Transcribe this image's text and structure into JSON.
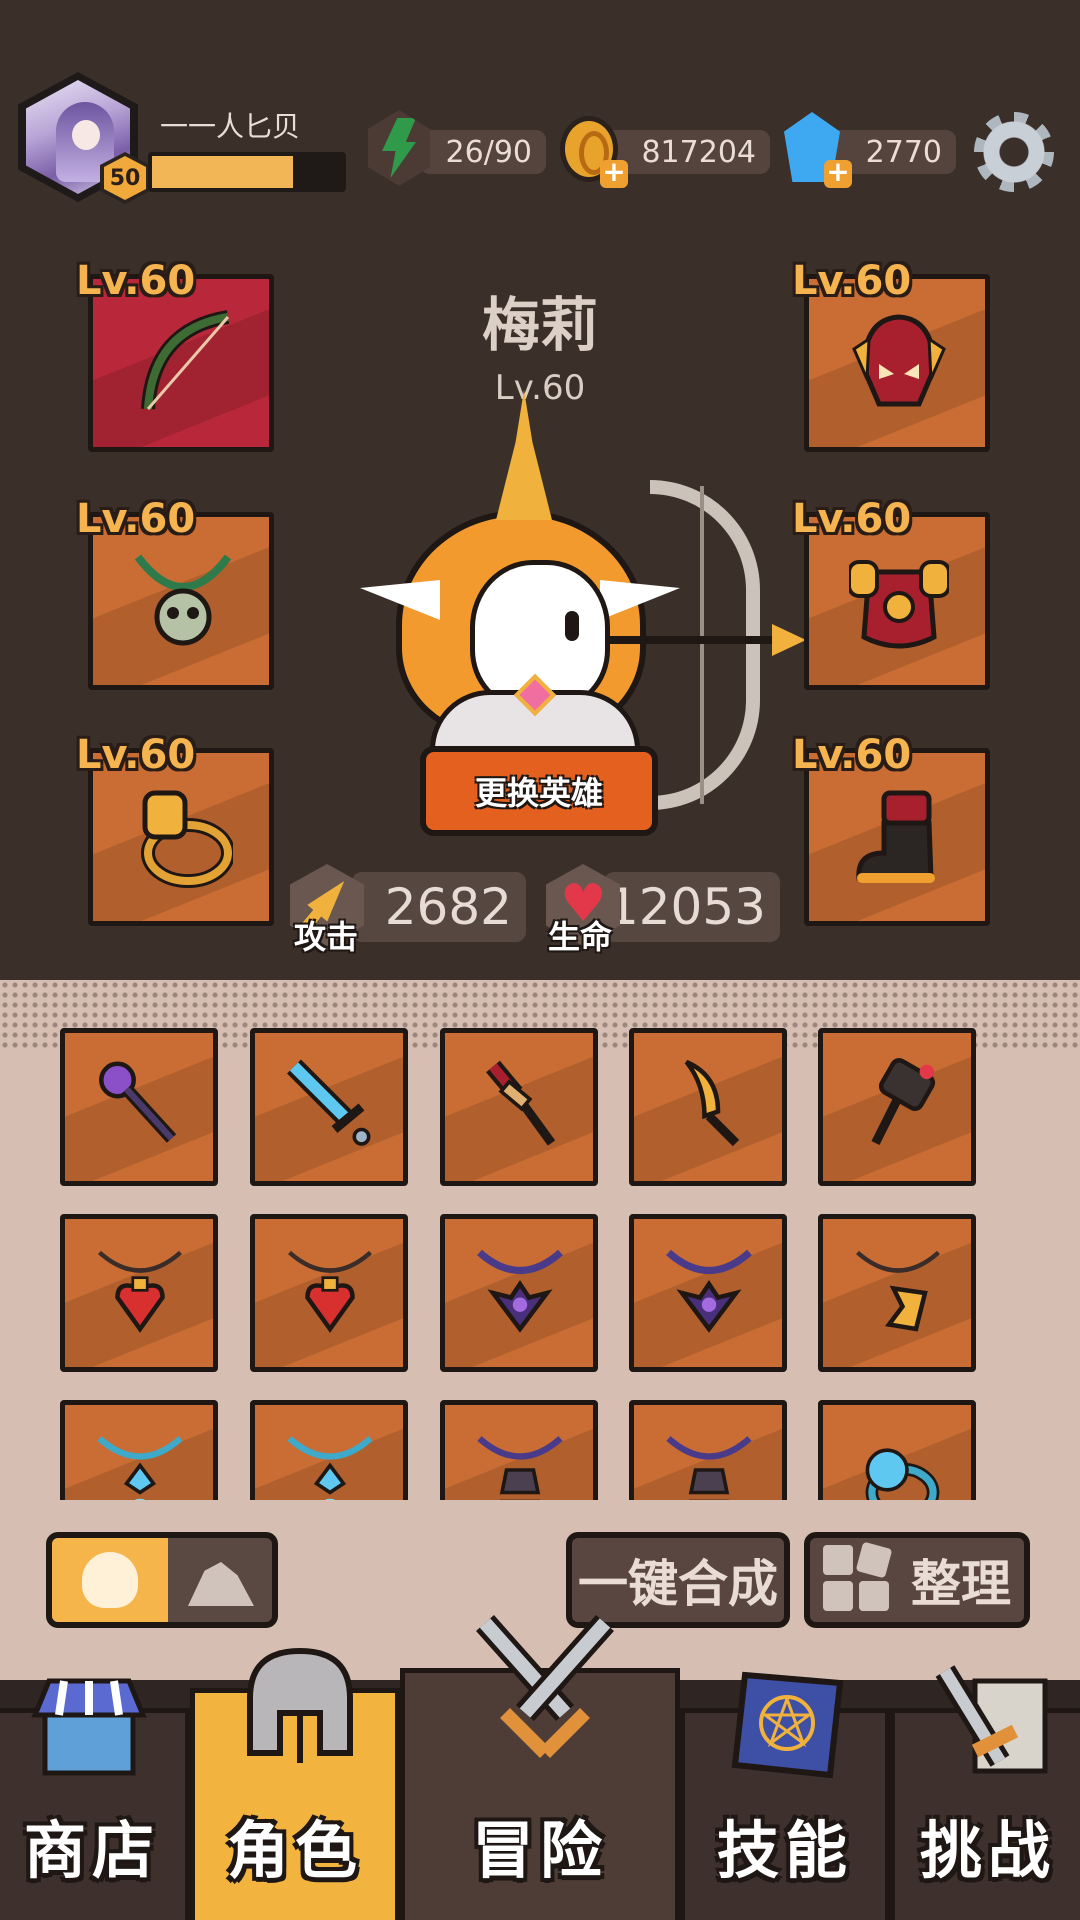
{
  "header": {
    "player_name": "一一人匕贝",
    "player_level": "50",
    "xp_progress": 0.74,
    "energy": "26/90",
    "coins": "817204",
    "gems": "2770"
  },
  "hero": {
    "name": "梅莉",
    "level": "Lv.60",
    "swap_label": "更换英雄",
    "attack_label": "攻击",
    "attack_value": "2682",
    "hp_label": "生命",
    "hp_value": "12053"
  },
  "equipment": {
    "bow_level": "Lv.60",
    "necklace_level": "Lv.60",
    "ring_level": "Lv.60",
    "helmet_level": "Lv.60",
    "armor_level": "Lv.60",
    "boots_level": "Lv.60"
  },
  "inventory": {
    "rows": [
      [
        "staff-icon",
        "sword-icon",
        "dagger-icon",
        "scimitar-icon",
        "hammer-icon"
      ],
      [
        "heart-pendant-icon",
        "heart-pendant-icon",
        "dark-pendant-icon",
        "dark-pendant-icon",
        "axe-pendant-icon"
      ],
      [
        "blue-pendant-icon",
        "blue-pendant-icon",
        "purple-pendant-icon",
        "purple-pendant-icon",
        "blue-ring-icon"
      ]
    ]
  },
  "actions": {
    "merge_label": "一键合成",
    "sort_label": "整理"
  },
  "nav": {
    "shop": "商店",
    "hero": "角色",
    "adventure": "冒险",
    "skills": "技能",
    "challenge": "挑战"
  },
  "colors": {
    "accent_orange": "#f2b43f",
    "slot_orange": "#c96d34",
    "button_orange": "#e3601e",
    "background_dark": "#3b2f2a"
  }
}
